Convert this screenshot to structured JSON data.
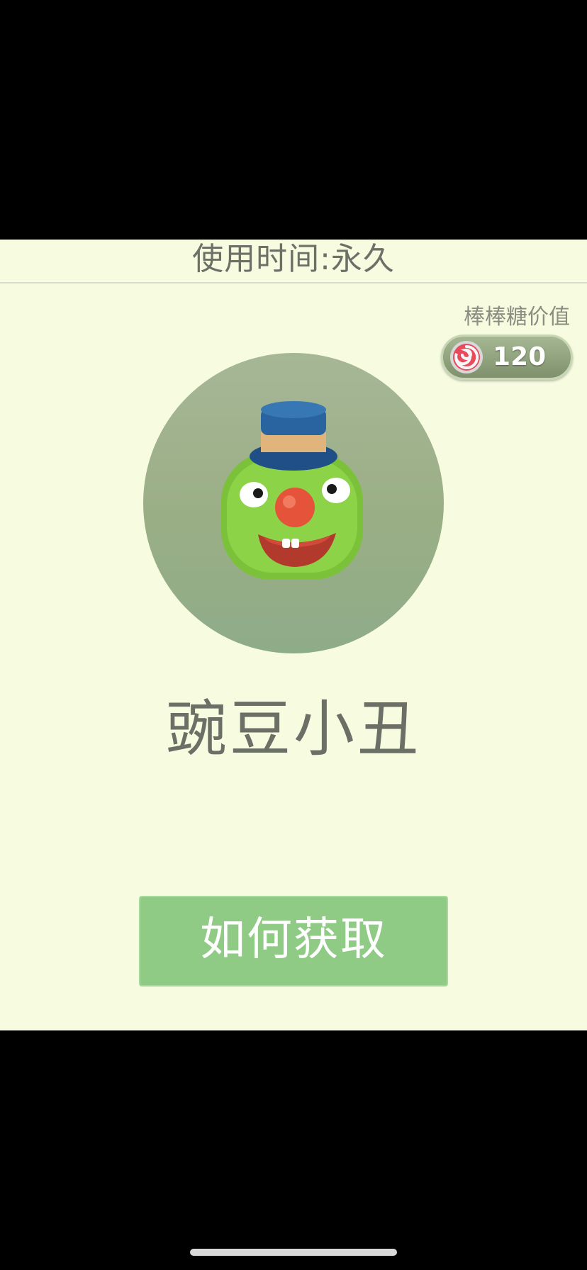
{
  "panel": {
    "duration_text": "使用时间:永久"
  },
  "value": {
    "label": "棒棒糖价值",
    "amount": "120",
    "icon": "lollipop-icon"
  },
  "item": {
    "name": "豌豆小丑",
    "avatar_icon": "pea-clown-avatar"
  },
  "actions": {
    "how_to_get_label": "如何获取"
  },
  "colors": {
    "panel_bg": "#f7fce1",
    "button_bg": "#8fcb85",
    "text_muted": "#6c7066"
  }
}
